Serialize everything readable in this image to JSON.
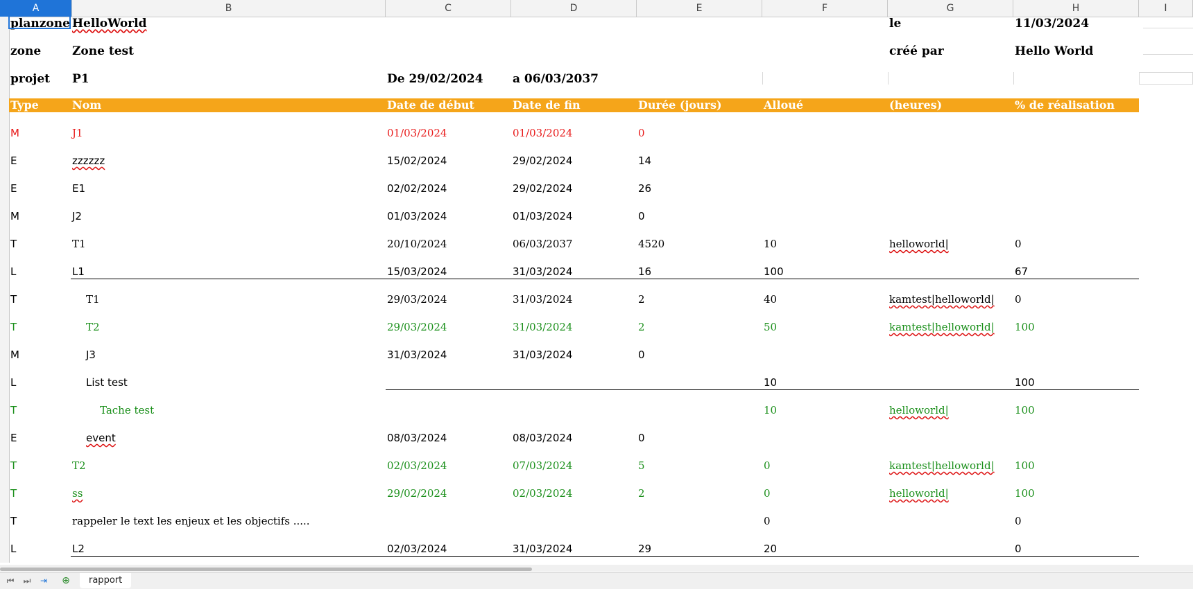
{
  "columns": [
    "A",
    "B",
    "C",
    "D",
    "E",
    "F",
    "G",
    "H",
    "I"
  ],
  "active_column": "A",
  "header_info": {
    "r1": {
      "a": "planzone",
      "b": "HelloWorld",
      "g": "le",
      "h": "11/03/2024"
    },
    "r2": {
      "a": "zone",
      "b": "Zone test",
      "g": "créé par",
      "h": "Hello World"
    },
    "r3": {
      "a": "projet",
      "b": "P1",
      "c": "De 29/02/2024",
      "d": "a 06/03/2037"
    }
  },
  "table_headers": [
    "Type",
    "Nom",
    "Date de début",
    "Date de fin",
    "Durée (jours)",
    "Alloué",
    "(heures)",
    "% de réalisation"
  ],
  "rows": [
    {
      "type": "M",
      "name": "J1",
      "start": "01/03/2024",
      "end": "01/03/2024",
      "days": "0",
      "alloc": "",
      "users": "",
      "pct": "",
      "color": "red",
      "indent": 0
    },
    {
      "type": "E",
      "name": "zzzzzz",
      "start": "15/02/2024",
      "end": "29/02/2024",
      "days": "14",
      "alloc": "",
      "users": "",
      "pct": "",
      "color": "black",
      "indent": 0
    },
    {
      "type": "E",
      "name": "E1",
      "start": "02/02/2024",
      "end": "29/02/2024",
      "days": "26",
      "alloc": "",
      "users": "",
      "pct": "",
      "color": "black",
      "indent": 0
    },
    {
      "type": "M",
      "name": "J2",
      "start": "01/03/2024",
      "end": "01/03/2024",
      "days": "0",
      "alloc": "",
      "users": "",
      "pct": "",
      "color": "black",
      "indent": 0
    },
    {
      "type": "T",
      "name": "T1",
      "start": "20/10/2024",
      "end": "06/03/2037",
      "days": "4520",
      "alloc": "10",
      "users": "helloworld|",
      "pct": "0",
      "color": "black",
      "indent": 0
    },
    {
      "type": "L",
      "name": "L1",
      "start": "15/03/2024",
      "end": "31/03/2024",
      "days": "16",
      "alloc": "100",
      "users": "",
      "pct": "67",
      "color": "black",
      "indent": 0
    },
    {
      "type": "T",
      "name": "T1",
      "start": "29/03/2024",
      "end": "31/03/2024",
      "days": "2",
      "alloc": "40",
      "users": "kamtest|helloworld|",
      "pct": "0",
      "color": "black",
      "indent": 1
    },
    {
      "type": "T",
      "name": "T2",
      "start": "29/03/2024",
      "end": "31/03/2024",
      "days": "2",
      "alloc": "50",
      "users": "kamtest|helloworld|",
      "pct": "100",
      "color": "green",
      "indent": 1
    },
    {
      "type": "M",
      "name": "J3",
      "start": "31/03/2024",
      "end": "31/03/2024",
      "days": "0",
      "alloc": "",
      "users": "",
      "pct": "",
      "color": "black",
      "indent": 1
    },
    {
      "type": "L",
      "name": "List test",
      "start": "",
      "end": "",
      "days": "",
      "alloc": "10",
      "users": "",
      "pct": "100",
      "color": "black",
      "indent": 1
    },
    {
      "type": "T",
      "name": "Tache test",
      "start": "",
      "end": "",
      "days": "",
      "alloc": "10",
      "users": "helloworld|",
      "pct": "100",
      "color": "green",
      "indent": 2
    },
    {
      "type": "E",
      "name": "event",
      "start": "08/03/2024",
      "end": "08/03/2024",
      "days": "0",
      "alloc": "",
      "users": "",
      "pct": "",
      "color": "black",
      "indent": 1
    },
    {
      "type": "T",
      "name": "T2",
      "start": "02/03/2024",
      "end": "07/03/2024",
      "days": "5",
      "alloc": "0",
      "users": "kamtest|helloworld|",
      "pct": "100",
      "color": "green",
      "indent": 0
    },
    {
      "type": "T",
      "name": "ss",
      "start": "29/02/2024",
      "end": "02/03/2024",
      "days": "2",
      "alloc": "0",
      "users": "helloworld|",
      "pct": "100",
      "color": "green",
      "indent": 0
    },
    {
      "type": "T",
      "name": "rappeler le text les enjeux et les objectifs .....",
      "start": "",
      "end": "",
      "days": "",
      "alloc": "0",
      "users": "",
      "pct": "0",
      "color": "black",
      "indent": 0
    },
    {
      "type": "L",
      "name": "L2",
      "start": "02/03/2024",
      "end": "31/03/2024",
      "days": "29",
      "alloc": "20",
      "users": "",
      "pct": "0",
      "color": "black",
      "indent": 0
    }
  ],
  "sheet_tabs": [
    "rapport"
  ],
  "colors": {
    "header_band": "#f5a51a",
    "selection": "#1f74d8",
    "red": "#e81919",
    "green": "#1a8f1a"
  }
}
